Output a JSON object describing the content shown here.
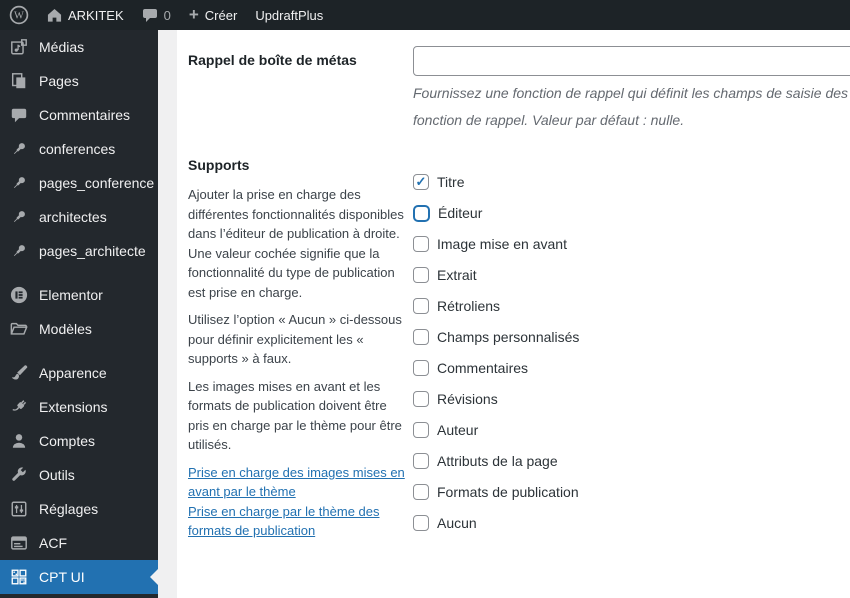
{
  "admin_bar": {
    "site_name": "ARKITEK",
    "comments_count": "0",
    "new_label": "Créer",
    "updraft_label": "UpdraftPlus"
  },
  "sidebar": {
    "items": [
      {
        "label": "Médias",
        "icon": "media-icon",
        "active": false
      },
      {
        "label": "Pages",
        "icon": "pages-icon",
        "active": false
      },
      {
        "label": "Commentaires",
        "icon": "comments-icon",
        "active": false
      },
      {
        "label": "conferences",
        "icon": "pushpin-icon",
        "active": false
      },
      {
        "label": "pages_conference",
        "icon": "pushpin-icon",
        "active": false
      },
      {
        "label": "architectes",
        "icon": "pushpin-icon",
        "active": false
      },
      {
        "label": "pages_architecte",
        "icon": "pushpin-icon",
        "active": false
      },
      {
        "label": "Elementor",
        "icon": "elementor-icon",
        "active": false
      },
      {
        "label": "Modèles",
        "icon": "templates-folder-icon",
        "active": false
      },
      {
        "label": "Apparence",
        "icon": "appearance-brush-icon",
        "active": false
      },
      {
        "label": "Extensions",
        "icon": "plugins-icon",
        "active": false
      },
      {
        "label": "Comptes",
        "icon": "users-icon",
        "active": false
      },
      {
        "label": "Outils",
        "icon": "tools-wrench-icon",
        "active": false
      },
      {
        "label": "Réglages",
        "icon": "settings-sliders-icon",
        "active": false
      },
      {
        "label": "ACF",
        "icon": "acf-icon",
        "active": false
      },
      {
        "label": "CPT UI",
        "icon": "cptui-grid-icon",
        "active": true
      }
    ]
  },
  "content": {
    "metabox_field": {
      "label": "Rappel de boîte de métas",
      "input_value": "",
      "description_line1": "Fournissez une fonction de rappel qui définit les champs de saisie des boîtes de métas pour le formulaire de modification. Faites des appels remove_meta_box() et add_meta_box() dans la",
      "description_line2": "fonction de rappel. Valeur par défaut : nulle."
    },
    "supports": {
      "heading": "Supports",
      "help_paragraphs": [
        "Ajouter la prise en charge des différentes fonctionnalités disponibles dans l’éditeur de publication à droite. Une valeur cochée signifie que la fonctionnalité du type de publication est prise en charge.",
        "Utilisez l’option « Aucun » ci-dessous pour définir explicitement les « supports » à faux.",
        "Les images mises en avant et les formats de publication doivent être pris en charge par le thème pour être utilisés."
      ],
      "links": [
        "Prise en charge des images mises en avant par le thème",
        "Prise en charge par le thème des formats de publication"
      ],
      "options": [
        {
          "label": "Titre",
          "checked": true,
          "focused": false
        },
        {
          "label": "Éditeur",
          "checked": false,
          "focused": true
        },
        {
          "label": "Image mise en avant",
          "checked": false,
          "focused": false
        },
        {
          "label": "Extrait",
          "checked": false,
          "focused": false
        },
        {
          "label": "Rétroliens",
          "checked": false,
          "focused": false
        },
        {
          "label": "Champs personnalisés",
          "checked": false,
          "focused": false
        },
        {
          "label": "Commentaires",
          "checked": false,
          "focused": false
        },
        {
          "label": "Révisions",
          "checked": false,
          "focused": false
        },
        {
          "label": "Auteur",
          "checked": false,
          "focused": false
        },
        {
          "label": "Attributs de la page",
          "checked": false,
          "focused": false
        },
        {
          "label": "Formats de publication",
          "checked": false,
          "focused": false
        },
        {
          "label": "Aucun",
          "checked": false,
          "focused": false
        }
      ]
    }
  },
  "colors": {
    "accent": "#2271b1",
    "admin_bar_bg": "#1d2327",
    "sidebar_bg": "#23282d",
    "menu_text": "#f0f0f1",
    "icon_gray": "#a7aaad",
    "content_bg": "#ffffff",
    "gutter_bg": "#f0f0f1",
    "muted_text": "#646970",
    "checkbox_border": "#8c8f94"
  }
}
